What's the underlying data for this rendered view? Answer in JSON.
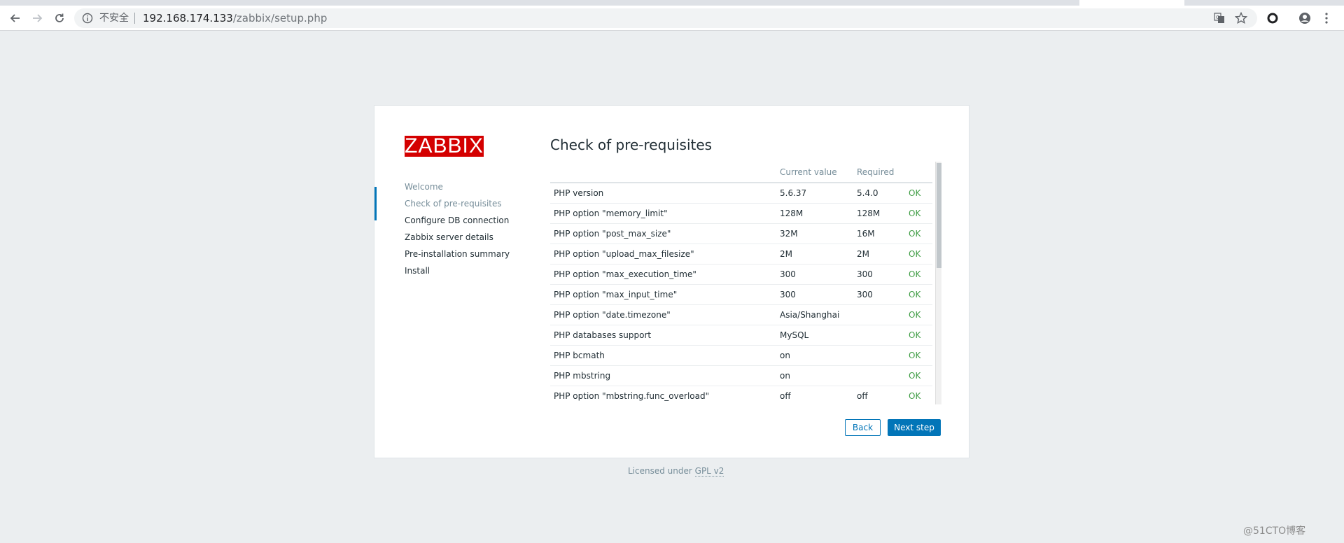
{
  "browser": {
    "security_label": "不安全",
    "url_host": "192.168.174.133",
    "url_path": "/zabbix/setup.php"
  },
  "setup": {
    "logo": "ZABBIX",
    "steps": [
      {
        "label": "Welcome",
        "state": "done"
      },
      {
        "label": "Check of pre-requisites",
        "state": "current"
      },
      {
        "label": "Configure DB connection",
        "state": "pending"
      },
      {
        "label": "Zabbix server details",
        "state": "pending"
      },
      {
        "label": "Pre-installation summary",
        "state": "pending"
      },
      {
        "label": "Install",
        "state": "pending"
      }
    ],
    "title": "Check of pre-requisites",
    "columns": [
      "",
      "Current value",
      "Required",
      ""
    ],
    "rows": [
      [
        "PHP version",
        "5.6.37",
        "5.4.0",
        "OK"
      ],
      [
        "PHP option \"memory_limit\"",
        "128M",
        "128M",
        "OK"
      ],
      [
        "PHP option \"post_max_size\"",
        "32M",
        "16M",
        "OK"
      ],
      [
        "PHP option \"upload_max_filesize\"",
        "2M",
        "2M",
        "OK"
      ],
      [
        "PHP option \"max_execution_time\"",
        "300",
        "300",
        "OK"
      ],
      [
        "PHP option \"max_input_time\"",
        "300",
        "300",
        "OK"
      ],
      [
        "PHP option \"date.timezone\"",
        "Asia/Shanghai",
        "",
        "OK"
      ],
      [
        "PHP databases support",
        "MySQL",
        "",
        "OK"
      ],
      [
        "PHP bcmath",
        "on",
        "",
        "OK"
      ],
      [
        "PHP mbstring",
        "on",
        "",
        "OK"
      ],
      [
        "PHP option \"mbstring.func_overload\"",
        "off",
        "off",
        "OK"
      ]
    ],
    "back_label": "Back",
    "next_label": "Next step"
  },
  "footer": {
    "prefix": "Licensed under ",
    "link": "GPL v2"
  },
  "watermark": "@51CTO博客",
  "colors": {
    "brand_red": "#d40000",
    "accent_blue": "#0275b8",
    "ok_green": "#429e47",
    "page_bg": "#ebeef0"
  }
}
